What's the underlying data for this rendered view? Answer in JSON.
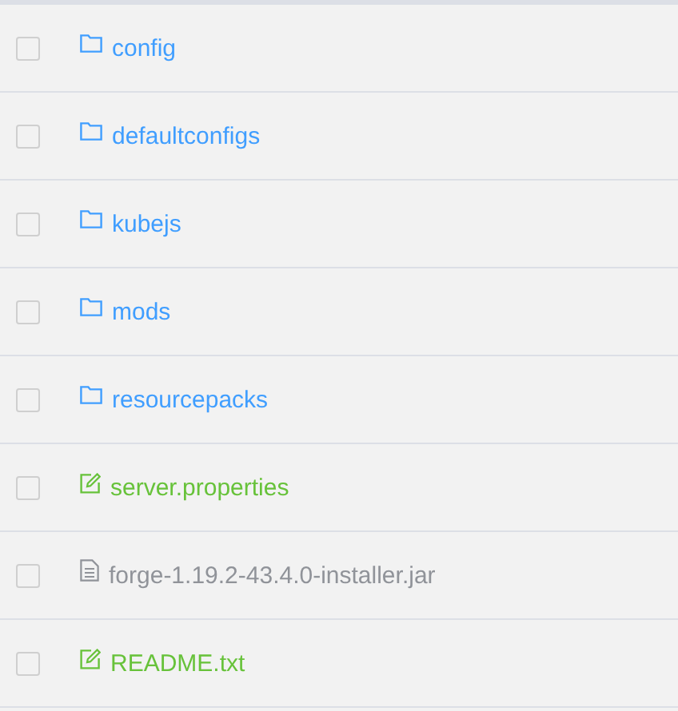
{
  "files": [
    {
      "name": "config",
      "kind": "folder",
      "checked": false
    },
    {
      "name": "defaultconfigs",
      "kind": "folder",
      "checked": false
    },
    {
      "name": "kubejs",
      "kind": "folder",
      "checked": false
    },
    {
      "name": "mods",
      "kind": "folder",
      "checked": false
    },
    {
      "name": "resourcepacks",
      "kind": "folder",
      "checked": false
    },
    {
      "name": "server.properties",
      "kind": "editable",
      "checked": false
    },
    {
      "name": "forge-1.19.2-43.4.0-installer.jar",
      "kind": "file",
      "checked": false
    },
    {
      "name": "README.txt",
      "kind": "editable",
      "checked": false
    }
  ]
}
